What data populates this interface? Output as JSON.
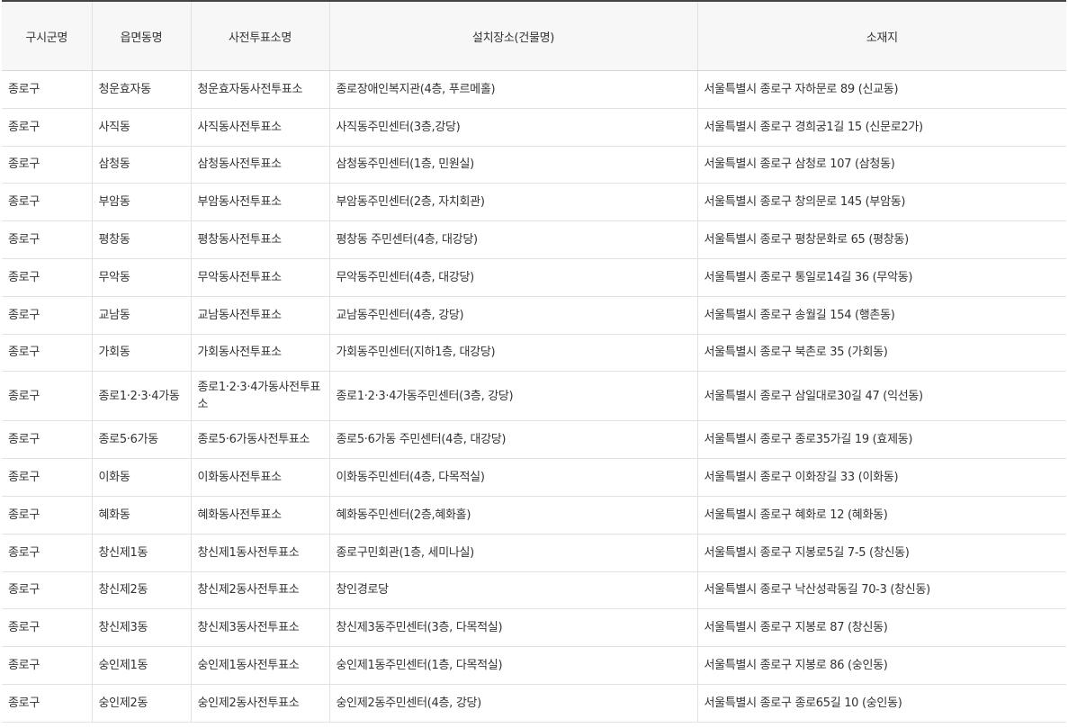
{
  "table": {
    "headers": [
      "구시군명",
      "읍면동명",
      "사전투표소명",
      "설치장소(건물명)",
      "소재지"
    ],
    "rows": [
      [
        "종로구",
        "청운효자동",
        "청운효자동사전투표소",
        "종로장애인복지관(4층, 푸르메홀)",
        "서울특별시 종로구 자하문로 89 (신교동)"
      ],
      [
        "종로구",
        "사직동",
        "사직동사전투표소",
        "사직동주민센터(3층,강당)",
        "서울특별시 종로구 경희궁1길 15 (신문로2가)"
      ],
      [
        "종로구",
        "삼청동",
        "삼청동사전투표소",
        "삼청동주민센터(1층, 민원실)",
        "서울특별시 종로구 삼청로 107 (삼청동)"
      ],
      [
        "종로구",
        "부암동",
        "부암동사전투표소",
        "부암동주민센터(2층, 자치회관)",
        "서울특별시 종로구 창의문로 145 (부암동)"
      ],
      [
        "종로구",
        "평창동",
        "평창동사전투표소",
        "평창동 주민센터(4층, 대강당)",
        "서울특별시 종로구 평창문화로 65 (평창동)"
      ],
      [
        "종로구",
        "무악동",
        "무악동사전투표소",
        "무악동주민센터(4층, 대강당)",
        "서울특별시 종로구 통일로14길 36 (무악동)"
      ],
      [
        "종로구",
        "교남동",
        "교남동사전투표소",
        "교남동주민센터(4층, 강당)",
        "서울특별시 종로구 송월길 154 (행촌동)"
      ],
      [
        "종로구",
        "가회동",
        "가회동사전투표소",
        "가회동주민센터(지하1층, 대강당)",
        "서울특별시 종로구 북촌로 35 (가회동)"
      ],
      [
        "종로구",
        "종로1·2·3·4가동",
        "종로1·2·3·4가동사전투표소",
        "종로1·2·3·4가동주민센터(3층, 강당)",
        "서울특별시 종로구 삼일대로30길 47 (익선동)"
      ],
      [
        "종로구",
        "종로5·6가동",
        "종로5·6가동사전투표소",
        "종로5·6가동 주민센터(4층, 대강당)",
        "서울특별시 종로구 종로35가길 19 (효제동)"
      ],
      [
        "종로구",
        "이화동",
        "이화동사전투표소",
        "이화동주민센터(4층, 다목적실)",
        "서울특별시 종로구 이화장길 33 (이화동)"
      ],
      [
        "종로구",
        "혜화동",
        "혜화동사전투표소",
        "혜화동주민센터(2층,혜화홀)",
        "서울특별시 종로구 혜화로 12 (혜화동)"
      ],
      [
        "종로구",
        "창신제1동",
        "창신제1동사전투표소",
        "종로구민회관(1층, 세미나실)",
        "서울특별시 종로구 지봉로5길 7-5 (창신동)"
      ],
      [
        "종로구",
        "창신제2동",
        "창신제2동사전투표소",
        "창인경로당",
        "서울특별시 종로구 낙산성곽동길 70-3 (창신동)"
      ],
      [
        "종로구",
        "창신제3동",
        "창신제3동사전투표소",
        "창신제3동주민센터(3층, 다목적실)",
        "서울특별시 종로구 지봉로 87 (창신동)"
      ],
      [
        "종로구",
        "숭인제1동",
        "숭인제1동사전투표소",
        "숭인제1동주민센터(1층, 다목적실)",
        "서울특별시 종로구 지봉로 86 (숭인동)"
      ],
      [
        "종로구",
        "숭인제2동",
        "숭인제2동사전투표소",
        "숭인제2동주민센터(4층, 강당)",
        "서울특별시 종로구 종로65길 10 (숭인동)"
      ]
    ]
  }
}
